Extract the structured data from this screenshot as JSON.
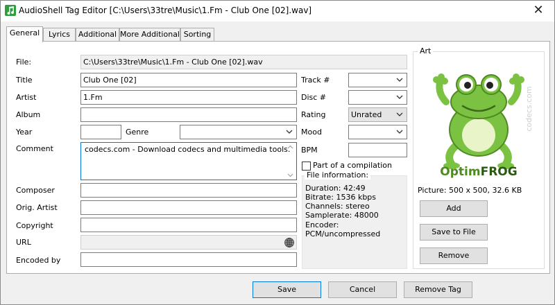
{
  "window": {
    "title": "AudioShell Tag Editor [C:\\Users\\33tre\\Music\\1.Fm - Club One [02].wav]",
    "close_symbol": "✕"
  },
  "tabs": [
    {
      "label": "General",
      "active": true
    },
    {
      "label": "Lyrics",
      "active": false
    },
    {
      "label": "Additional",
      "active": false
    },
    {
      "label": "More Additional",
      "active": false
    },
    {
      "label": "Sorting",
      "active": false
    }
  ],
  "labels": {
    "file": "File:",
    "title": "Title",
    "artist": "Artist",
    "album": "Album",
    "year": "Year",
    "genre": "Genre",
    "comment": "Comment",
    "composer": "Composer",
    "orig_artist": "Orig. Artist",
    "copyright": "Copyright",
    "url": "URL",
    "encoded_by": "Encoded by",
    "track": "Track #",
    "disc": "Disc #",
    "rating": "Rating",
    "mood": "Mood",
    "bpm": "BPM",
    "compilation": "Part of a compilation",
    "file_information": "File information:",
    "art": "Art"
  },
  "values": {
    "file": "C:\\Users\\33tre\\Music\\1.Fm - Club One [02].wav",
    "title": "Club One [02]",
    "artist": "1.Fm",
    "album": "",
    "year": "",
    "genre": "",
    "comment": "codecs.com - Download codecs and multimedia tools.",
    "composer": "",
    "orig_artist": "",
    "copyright": "",
    "url": "",
    "encoded_by": "",
    "track": "",
    "disc": "",
    "rating": "Unrated",
    "mood": "",
    "bpm": "",
    "compilation_checked": false
  },
  "file_info": {
    "duration": "Duration: 42:49",
    "bitrate": "Bitrate: 1536 kbps",
    "channels": "Channels: stereo",
    "samplerate": "Samplerate: 48000",
    "encoder_label": "Encoder:",
    "encoder_value": "PCM/uncompressed"
  },
  "art": {
    "logo_text_part1": "Optim",
    "logo_text_part2": "FROG",
    "watermark": "codecs.com",
    "picture_info": "Picture: 500 x 500, 32.6 KB",
    "add": "Add",
    "save_to_file": "Save to File",
    "remove": "Remove"
  },
  "footer": {
    "save": "Save",
    "cancel": "Cancel",
    "remove_tag": "Remove Tag"
  },
  "colors": {
    "accent": "#0078d7",
    "frog_green": "#7cc242",
    "app_icon_green": "#2e9e3e"
  }
}
